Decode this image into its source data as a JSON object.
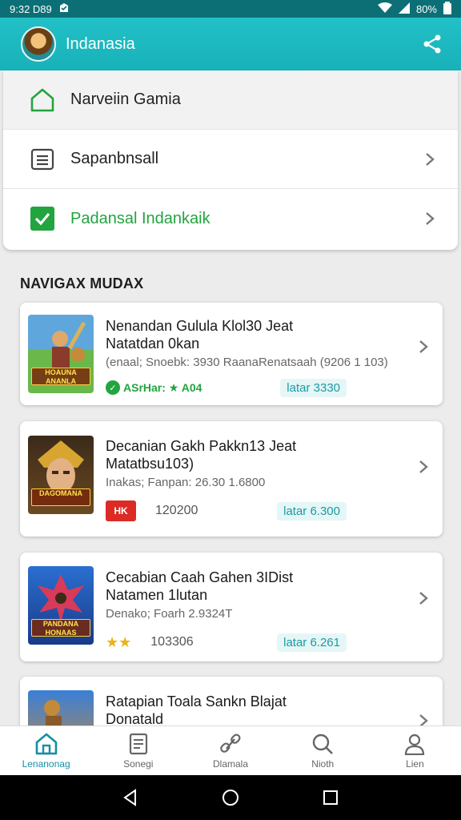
{
  "status_bar": {
    "time": "9:32 D89",
    "battery": "80%"
  },
  "app_bar": {
    "title": "Indanasia",
    "share_icon": "share-icon"
  },
  "menu": [
    {
      "label": "Narveiin Gamia",
      "icon": "home-icon",
      "chevron": false,
      "active": true,
      "color": "#222222"
    },
    {
      "label": "Sapanbnsall",
      "icon": "list-icon",
      "chevron": true,
      "active": false,
      "color": "#222222"
    },
    {
      "label": "Padansal Indankaik",
      "icon": "checkbox-icon",
      "chevron": true,
      "active": false,
      "color": "#22a43f"
    }
  ],
  "section_title": "NAVIGAX MUDAX",
  "games": [
    {
      "title_1": "Nenandan Gulula Klol30 Jeat",
      "title_2": "Natatdan 0kan",
      "sub": "(enaal; Snoebk: 3930 RaanaRenatsaah (9206 1 103)",
      "tag": "ASrHar: ★ A04",
      "count": "",
      "price": "latar 3330",
      "thumb_text": "HOAUNA ANANLA",
      "badge": "tag"
    },
    {
      "title_1": "Decanian Gakh Pakkn13 Jeat",
      "title_2": "Matatbsu103)",
      "sub": "Inakas; Fanpan: 26.30 1.6800",
      "tag": "HK",
      "count": "120200",
      "price": "latar 6.300",
      "thumb_text": "DAGOMANA",
      "badge": "red"
    },
    {
      "title_1": "Cecabian Caah Gahen 3IDist",
      "title_2": "Natamen 1lutan",
      "sub": "Denako; Foarh 2.9324T",
      "tag": "★★",
      "count": "103306",
      "price": "latar 6.261",
      "thumb_text": "PANDANA HONAAS",
      "badge": "stars"
    },
    {
      "title_1": "Ratapian Toala Sankn Blajat",
      "title_2": "Donatald",
      "sub": "",
      "tag": "",
      "count": "",
      "price": "",
      "thumb_text": "",
      "badge": ""
    }
  ],
  "bottom_nav": [
    {
      "label": "Lenanonag",
      "icon": "home-icon"
    },
    {
      "label": "Sonegi",
      "icon": "document-icon"
    },
    {
      "label": "Dlamala",
      "icon": "link-icon"
    },
    {
      "label": "Nioth",
      "icon": "search-icon"
    },
    {
      "label": "Lien",
      "icon": "user-icon"
    }
  ]
}
